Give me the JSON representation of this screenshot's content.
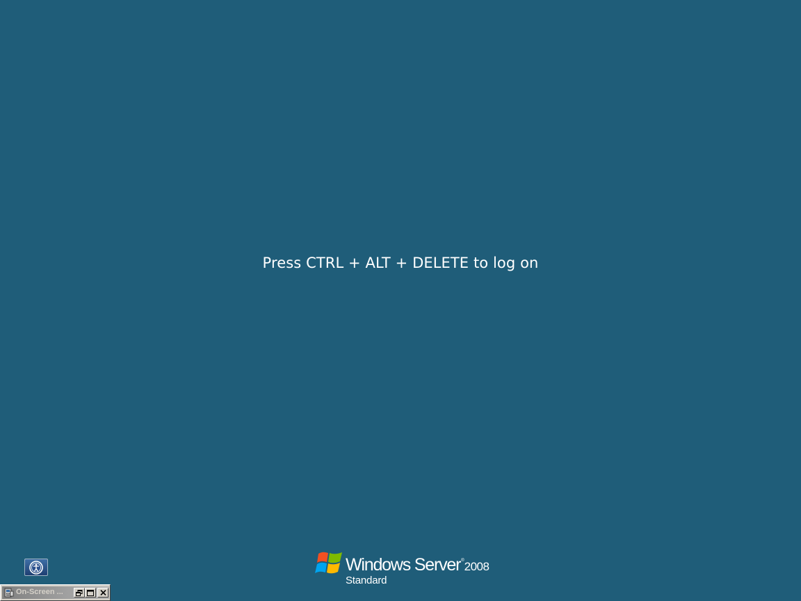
{
  "logon": {
    "prompt": "Press CTRL + ALT + DELETE to log on"
  },
  "ease_of_access": {
    "icon": "ease-of-access-icon"
  },
  "branding": {
    "logo_icon": "windows-flag-icon",
    "product_name": "Windows Server",
    "trademark": "®",
    "version": "2008",
    "edition": "Standard"
  },
  "on_screen_keyboard": {
    "title": "On-Screen ...",
    "icon": "keyboard-app-icon",
    "buttons": {
      "restore_icon": "restore-icon",
      "maximize_icon": "maximize-icon",
      "close_icon": "close-icon"
    }
  },
  "colors": {
    "background": "#1f5d79",
    "text": "#ffffff",
    "taskbar_gray": "#d4d0c8"
  }
}
